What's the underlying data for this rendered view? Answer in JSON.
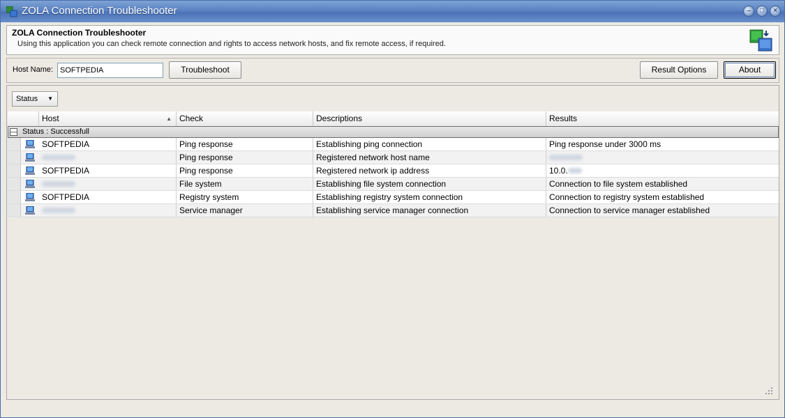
{
  "window": {
    "title": "ZOLA Connection Troubleshooter"
  },
  "header": {
    "title": "ZOLA Connection Troubleshooter",
    "description": "Using this application you can check remote connection and rights to access network hosts, and fix remote access, if required."
  },
  "toolbar": {
    "host_label": "Host Name:",
    "host_value": "SOFTPEDIA",
    "troubleshoot_label": "Troubleshoot",
    "result_options_label": "Result Options",
    "about_label": "About"
  },
  "filter": {
    "status_label": "Status"
  },
  "table": {
    "columns": [
      "Host",
      "Check",
      "Descriptions",
      "Results"
    ],
    "group_label": "Status : Successfull",
    "rows": [
      {
        "host": "SOFTPEDIA",
        "check": "Ping response",
        "description": "Establishing ping connection",
        "result": "Ping response under 3000 ms"
      },
      {
        "host": "",
        "check": "Ping response",
        "description": "Registered network host name",
        "result": ""
      },
      {
        "host": "SOFTPEDIA",
        "check": "Ping response",
        "description": "Registered network ip address",
        "result": "10.0."
      },
      {
        "host": "",
        "check": "File system",
        "description": "Establishing file system connection",
        "result": "Connection to file system established"
      },
      {
        "host": "SOFTPEDIA",
        "check": "Registry system",
        "description": "Establishing registry system connection",
        "result": "Connection to registry system established"
      },
      {
        "host": "",
        "check": "Service manager",
        "description": "Establishing service manager connection",
        "result": "Connection to service manager established"
      }
    ]
  }
}
